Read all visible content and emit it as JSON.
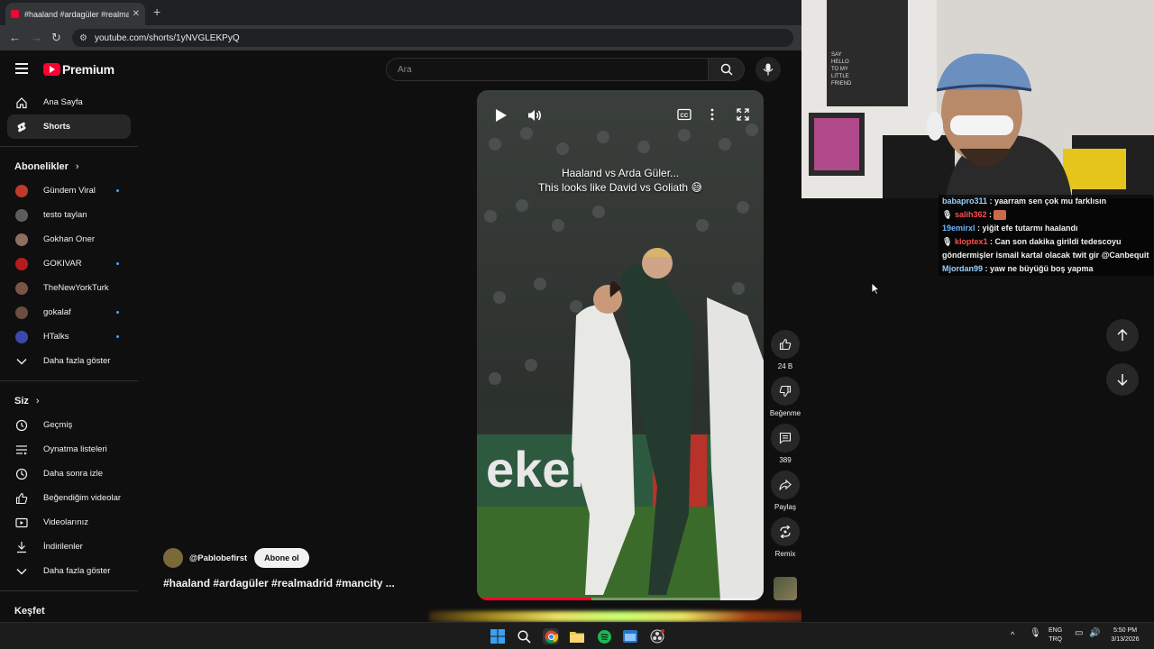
{
  "browser": {
    "tab_title": "#haaland #ardagüler #realmadri",
    "url": "youtube.com/shorts/1yNVGLEKPyQ"
  },
  "youtube": {
    "logo_text": "Premium",
    "search_placeholder": "Ara",
    "sidebar": {
      "home": "Ana Sayfa",
      "shorts": "Shorts",
      "subscriptions_title": "Abonelikler",
      "channels": [
        {
          "name": "Gündem Viral",
          "dot": true,
          "color": "#c0392b"
        },
        {
          "name": "testo taylan",
          "dot": false,
          "color": "#5d5d5d"
        },
        {
          "name": "Gokhan Oner",
          "dot": false,
          "color": "#8d6e63"
        },
        {
          "name": "GOKIVAR",
          "dot": true,
          "color": "#b71c1c"
        },
        {
          "name": "TheNewYorkTurk",
          "dot": false,
          "color": "#795548"
        },
        {
          "name": "gokalaf",
          "dot": true,
          "color": "#6d4c41"
        },
        {
          "name": "HTalks",
          "dot": true,
          "color": "#3949ab"
        }
      ],
      "show_more": "Daha fazla göster",
      "you_title": "Siz",
      "you_items": {
        "history": "Geçmiş",
        "playlists": "Oynatma listeleri",
        "watch_later": "Daha sonra izle",
        "liked": "Beğendiğim videolar",
        "your_videos": "Videolarınız",
        "downloads": "İndirilenler",
        "show_more": "Daha fazla göster"
      },
      "explore_title": "Keşfet"
    },
    "short": {
      "caption_line1": "Haaland vs Arda Güler...",
      "caption_line2": "This looks like David vs Goliath 😅",
      "progress": 0.4,
      "likes": "24 B",
      "dislike_label": "Beğenme",
      "comments": "389",
      "share_label": "Paylaş",
      "remix_label": "Remix",
      "channel": "@Pablobefirst",
      "subscribe": "Abone ol",
      "hashtags": "#haaland #ardagüler #realmadrid #mancity ..."
    }
  },
  "chat": [
    {
      "user": "babapro311",
      "color": "#9ad0ff",
      "text": " : yaarram sen çok mu farklısın",
      "badge": false
    },
    {
      "user": "salih362",
      "color": "#ff4d4d",
      "text": " : ",
      "badge": true,
      "emote": true
    },
    {
      "user": "19emirxl",
      "color": "#6bb6ff",
      "text": " : yiğit efe tutarmı haalandı",
      "badge": false
    },
    {
      "user": "kloptex1",
      "color": "#ff4d4d",
      "text": " : Can son dakika girildi tedescoyu göndermişler ismail kartal olacak twit gir @Canbequit",
      "badge": true
    },
    {
      "user": "Mjordan99",
      "color": "#9ad0ff",
      "text": " : yaw ne büyüğü boş yapma",
      "badge": false
    }
  ],
  "taskbar": {
    "lang_line1": "ENG",
    "lang_line2": "TRQ",
    "time": "5:50 PM",
    "date": "3/13/2026"
  }
}
